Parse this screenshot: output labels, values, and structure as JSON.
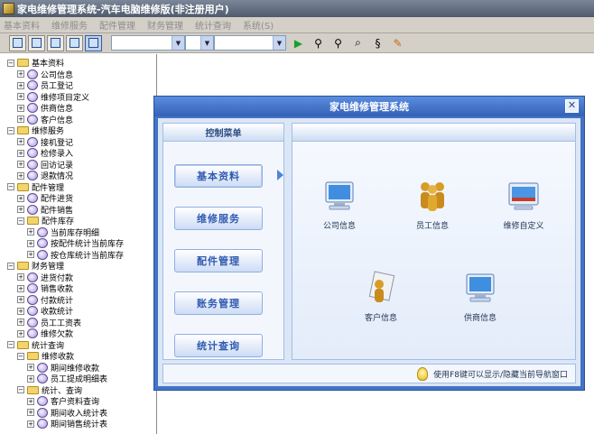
{
  "window": {
    "title": "家电维修管理系统-汽车电脑维修版(非注册用户)"
  },
  "menubar": [
    "基本资料",
    "维修服务",
    "配件管理",
    "财务管理",
    "统计查询",
    "系统(S)"
  ],
  "tree": [
    {
      "label": "基本资料",
      "kind": "folder",
      "level": 0
    },
    {
      "label": "公司信息",
      "kind": "leaf",
      "level": 1
    },
    {
      "label": "员工登记",
      "kind": "leaf",
      "level": 1
    },
    {
      "label": "维修项目定义",
      "kind": "leaf",
      "level": 1
    },
    {
      "label": "供商信息",
      "kind": "leaf",
      "level": 1
    },
    {
      "label": "客户信息",
      "kind": "leaf",
      "level": 1
    },
    {
      "label": "维修服务",
      "kind": "folder",
      "level": 0
    },
    {
      "label": "接机登记",
      "kind": "leaf",
      "level": 1
    },
    {
      "label": "检修录入",
      "kind": "leaf",
      "level": 1
    },
    {
      "label": "回访记录",
      "kind": "leaf",
      "level": 1
    },
    {
      "label": "退款情况",
      "kind": "leaf",
      "level": 1
    },
    {
      "label": "配件管理",
      "kind": "folder",
      "level": 0
    },
    {
      "label": "配件进货",
      "kind": "leaf",
      "level": 1
    },
    {
      "label": "配件销售",
      "kind": "leaf",
      "level": 1
    },
    {
      "label": "配件库存",
      "kind": "folder",
      "level": 1
    },
    {
      "label": "当前库存明细",
      "kind": "leaf",
      "level": 2
    },
    {
      "label": "按配件统计当前库存",
      "kind": "leaf",
      "level": 2
    },
    {
      "label": "按仓库统计当前库存",
      "kind": "leaf",
      "level": 2
    },
    {
      "label": "财务管理",
      "kind": "folder",
      "level": 0
    },
    {
      "label": "进货付款",
      "kind": "leaf",
      "level": 1
    },
    {
      "label": "销售收款",
      "kind": "leaf",
      "level": 1
    },
    {
      "label": "付款统计",
      "kind": "leaf",
      "level": 1
    },
    {
      "label": "收款统计",
      "kind": "leaf",
      "level": 1
    },
    {
      "label": "员工工资表",
      "kind": "leaf",
      "level": 1
    },
    {
      "label": "维修欠款",
      "kind": "leaf",
      "level": 1
    },
    {
      "label": "统计查询",
      "kind": "folder",
      "level": 0
    },
    {
      "label": "维修收款",
      "kind": "folder",
      "level": 1
    },
    {
      "label": "期间维修收款",
      "kind": "leaf",
      "level": 2
    },
    {
      "label": "员工提成明细表",
      "kind": "leaf",
      "level": 2
    },
    {
      "label": "统计、查询",
      "kind": "folder",
      "level": 1
    },
    {
      "label": "客户资料查询",
      "kind": "leaf",
      "level": 2
    },
    {
      "label": "期间收入统计表",
      "kind": "leaf",
      "level": 2
    },
    {
      "label": "期间销售统计表",
      "kind": "leaf",
      "level": 2
    }
  ],
  "dialog": {
    "title": "家电维修管理系统",
    "menu_header": "控制菜单",
    "menu_buttons": [
      "基本资料",
      "维修服务",
      "配件管理",
      "账务管理",
      "统计查询"
    ],
    "tiles": [
      "公司信息",
      "员工信息",
      "维修自定义",
      "客户信息",
      "供商信息"
    ],
    "tile_icons": [
      "monitor-icon",
      "people-icon",
      "window-icon",
      "person-doc-icon",
      "monitor-icon"
    ],
    "footer": "使用F8键可以显示/隐藏当前导航窗口",
    "close_glyph": "✕"
  },
  "colors": {
    "accent": "#4373c8",
    "menu_text": "#305ab0"
  }
}
